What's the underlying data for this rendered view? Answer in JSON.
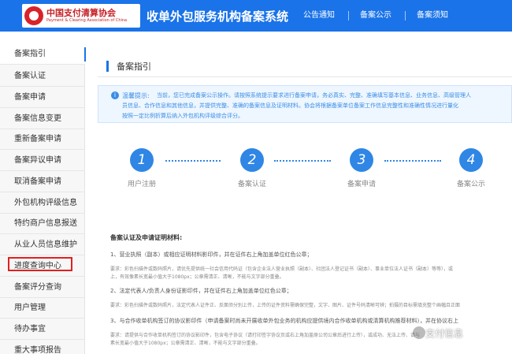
{
  "header": {
    "logo_cn": "中国支付清算协会",
    "logo_en": "Payment & Clearing Association of China",
    "system_title": "收单外包服务机构备案系统",
    "nav": [
      "公告通知",
      "备案公示",
      "备案须知"
    ]
  },
  "sidebar": {
    "items": [
      "备案指引",
      "备案认证",
      "备案申请",
      "备案信息变更",
      "重新备案申请",
      "备案异议申请",
      "取消备案申请",
      "外包机构评级信息",
      "特约商户信息报送",
      "从业人员信息维护",
      "进度查询中心",
      "备案评分查询",
      "用户管理",
      "待办事宜",
      "重大事项报告"
    ]
  },
  "main": {
    "title": "备案指引",
    "tip_label": "温馨提示:",
    "tip_lines": [
      "当前，您已完成备案公示操作。请按照系统提示要求进行备案申请，务必真实、完整、准确填写基本信息、业务信息、高级管理人",
      "员信息、合作信息和其他信息，并提供完整、准确的备案信息及证明材料。协会将根据备案单位备案工作信息完整性和准确性情况进行量化",
      "按照一定比例折算后纳入外包机构评级综合评分。"
    ],
    "steps": [
      {
        "num": "1",
        "label": "用户注册"
      },
      {
        "num": "2",
        "label": "备案认证"
      },
      {
        "num": "3",
        "label": "备案申请"
      },
      {
        "num": "4",
        "label": "备案公示"
      }
    ],
    "section_heading": "备案认证及申请证明材料:",
    "doc_items": [
      {
        "line": "1、营业执照（副本）或相应证明材料影印件，并在证件右上角加盖单位红色公章；",
        "sub": [
          "要求：彩色扫描件或数码照片，请优先提供统一社会信用代码证（包含企业法人营业执照（副本）、社团法人登记证书（副本）、事业单位法人证书（副本）等等），或",
          "上，有效像素长宽最小值大于1080px；公章需清正、清晰，不能与文字部分重叠。"
        ]
      },
      {
        "line": "2、法定代表人/负责人身份证影印件，并在证件右上角加盖单位红色公章；",
        "sub": [
          "要求：彩色扫描件或数码照片，法定代表人证件正、反面须分别上传，上传的证件资料需确保完整，文字、图片、证件号码清晰可辨；拍摄的目标需填充整个画幅且正面"
        ]
      },
      {
        "line": "3、与合作收单机构签订的协议影印件（申请备案时尚未开展收单外包业务的机构应提供境内合作收单机构或清算机构推荐材料），并在协议右上",
        "sub": [
          "要求：请提供与合作收单机构签订的协议影印件，包含电子协议（请打印签字协议页或右上角加盖原公司公章后进行上传），或成功、无法上传、请与",
          "素长宽最小值大于1080px；公章需清正、清晰，不能与文字部分重叠。"
        ]
      }
    ]
  },
  "watermark": "支付信息"
}
